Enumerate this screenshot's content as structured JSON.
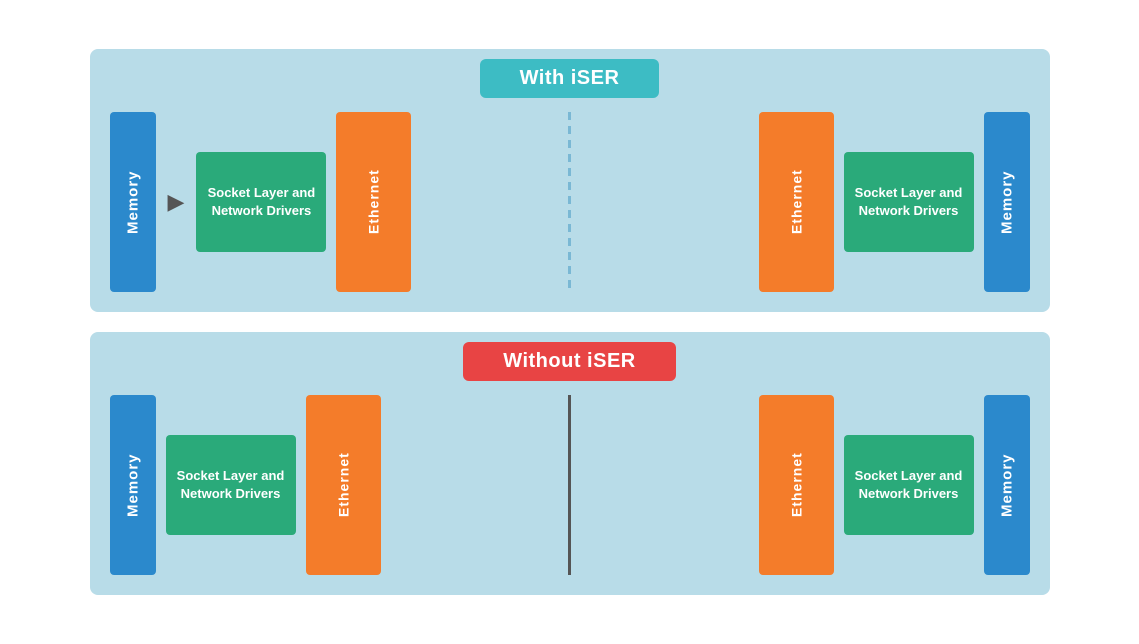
{
  "diagrams": [
    {
      "id": "with-iser",
      "title": "With iSER",
      "title_class": "title-with",
      "divider_style": "dashed",
      "left": {
        "memory": "Memory",
        "socket": "Socket Layer and Network Drivers",
        "ethernet": "Ethernet"
      },
      "right": {
        "ethernet": "Ethernet",
        "socket": "Socket Layer and Network Drivers",
        "memory": "Memory"
      }
    },
    {
      "id": "without-iser",
      "title": "Without iSER",
      "title_class": "title-without",
      "divider_style": "solid",
      "left": {
        "memory": "Memory",
        "socket": "Socket Layer and Network Drivers",
        "ethernet": "Ethernet"
      },
      "right": {
        "ethernet": "Ethernet",
        "socket": "Socket Layer and Network Drivers",
        "memory": "Memory"
      }
    }
  ]
}
